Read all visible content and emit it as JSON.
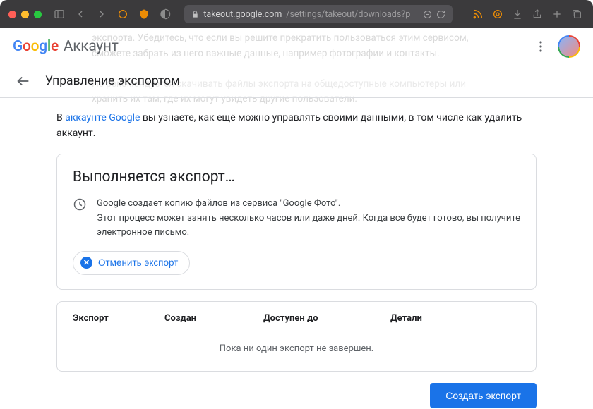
{
  "browser": {
    "url_host": "takeout.google.com",
    "url_path": "/settings/takeout/downloads?p"
  },
  "header": {
    "logo_account_text": "Аккаунт"
  },
  "subheader": {
    "title": "Управление экспортом"
  },
  "ghost": {
    "line1": "экспорта. Убедитесь, что если вы решите прекратить пользоваться этим сервисом,",
    "line2": "сможете забрать из него важные данные, например фотографии и контакты.",
    "line3": "Не рекомендуется скачивать файлы экспорта на общедоступные компьютеры или",
    "line4": "хранить их там, где их могут увидеть другие пользователи."
  },
  "intro": {
    "prefix": "В ",
    "link_text": "аккаунте Google",
    "suffix": " вы узнаете, как ещё можно управлять своими данными, в том числе как удалить аккаунт."
  },
  "progress_card": {
    "title": "Выполняется экспорт…",
    "line1": "Google создает копию файлов из сервиса \"Google Фото\".",
    "line2": "Этот процесс может занять несколько часов или даже дней. Когда все будет готово, вы получите электронное письмо.",
    "cancel_label": "Отменить экспорт"
  },
  "table": {
    "columns": {
      "c1": "Экспорт",
      "c2": "Создан",
      "c3": "Доступен до",
      "c4": "Детали"
    },
    "empty_text": "Пока ни один экспорт не завершен."
  },
  "actions": {
    "create_label": "Создать экспорт"
  }
}
